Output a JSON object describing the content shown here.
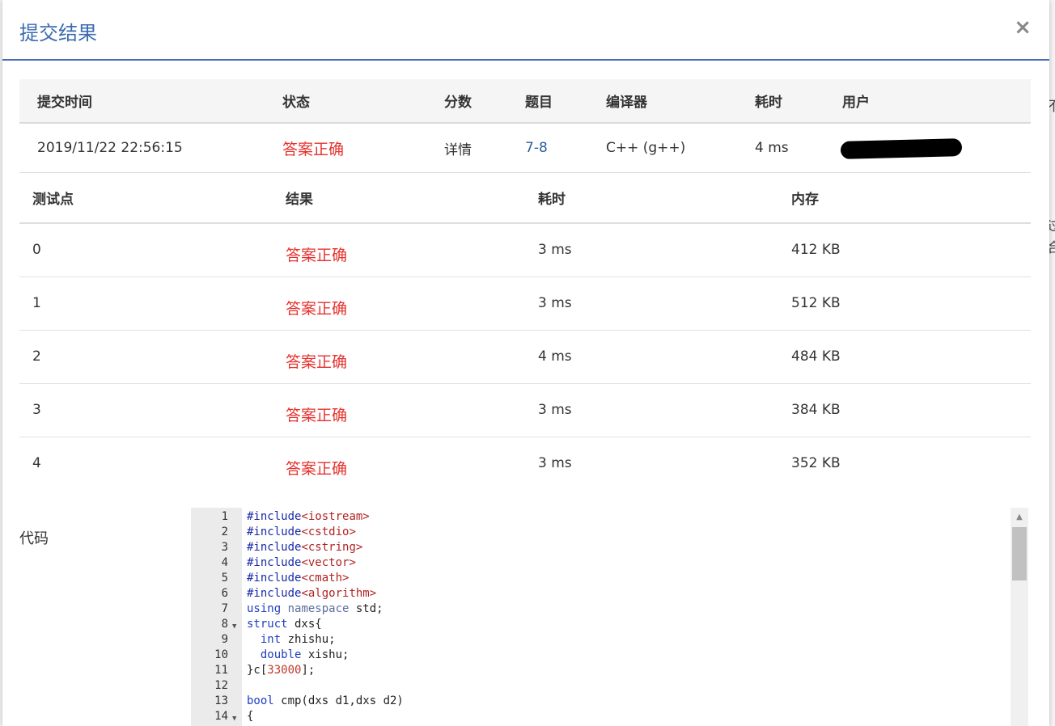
{
  "modal": {
    "title": "提交结果",
    "close_label": "×"
  },
  "summary": {
    "headers": [
      "提交时间",
      "状态",
      "分数",
      "题目",
      "编译器",
      "耗时",
      "用户"
    ],
    "row": {
      "time": "2019/11/22 22:56:15",
      "status": "答案正确",
      "score": "详情",
      "problem": "7-8",
      "compiler": "C++ (g++)",
      "duration": "4 ms"
    }
  },
  "cases": {
    "headers": [
      "测试点",
      "结果",
      "耗时",
      "内存"
    ],
    "rows": [
      {
        "id": "0",
        "result": "答案正确",
        "time": "3 ms",
        "memory": "412 KB"
      },
      {
        "id": "1",
        "result": "答案正确",
        "time": "3 ms",
        "memory": "512 KB"
      },
      {
        "id": "2",
        "result": "答案正确",
        "time": "4 ms",
        "memory": "484 KB"
      },
      {
        "id": "3",
        "result": "答案正确",
        "time": "3 ms",
        "memory": "384 KB"
      },
      {
        "id": "4",
        "result": "答案正确",
        "time": "3 ms",
        "memory": "352 KB"
      }
    ]
  },
  "code": {
    "label": "代码",
    "line_numbers": [
      "1",
      "2",
      "3",
      "4",
      "5",
      "6",
      "7",
      "8",
      "9",
      "10",
      "11",
      "12",
      "13",
      "14"
    ],
    "lines": [
      "#include<iostream>",
      "#include<cstdio>",
      "#include<cstring>",
      "#include<vector>",
      "#include<cmath>",
      "#include<algorithm>",
      "using namespace std;",
      "struct dxs{",
      "  int zhishu;",
      "  double xishu;",
      "}c[33000];",
      "",
      "bool cmp(dxs d1,dxs d2)",
      "{"
    ]
  },
  "background": {
    "chars": [
      "不",
      "过",
      "合"
    ]
  },
  "colors": {
    "accent": "#4a6db3",
    "success": "#e5322d",
    "link": "#2e5e9a"
  }
}
